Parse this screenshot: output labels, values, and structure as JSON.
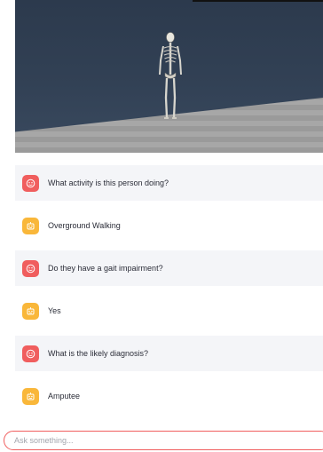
{
  "viewer": {
    "background_color": "#324155",
    "floor_color": "#a0a0a0",
    "figure": "skeleton-model"
  },
  "chat": {
    "messages": [
      {
        "role": "user",
        "text": "What activity is this person doing?",
        "avatar_icon": "user-face-icon"
      },
      {
        "role": "assistant",
        "text": "Overground Walking",
        "avatar_icon": "bot-icon"
      },
      {
        "role": "user",
        "text": "Do they have a gait impairment?",
        "avatar_icon": "user-face-icon"
      },
      {
        "role": "assistant",
        "text": "Yes",
        "avatar_icon": "bot-icon"
      },
      {
        "role": "user",
        "text": "What is the likely diagnosis?",
        "avatar_icon": "user-face-icon"
      },
      {
        "role": "assistant",
        "text": "Amputee",
        "avatar_icon": "bot-icon"
      }
    ]
  },
  "input": {
    "placeholder": "Ask something...",
    "value": ""
  },
  "colors": {
    "user_avatar": "#f05e5e",
    "bot_avatar": "#f9b73a",
    "user_message_bg": "#f4f5f8",
    "input_border": "#f05e5e"
  }
}
